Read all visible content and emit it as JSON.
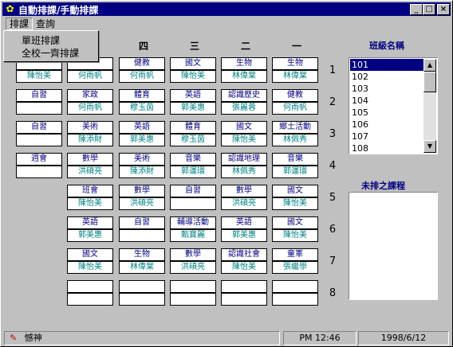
{
  "window": {
    "title": "自動排課/手動排課",
    "app_icon": "gear-icon"
  },
  "title_buttons": {
    "minimize": "_",
    "maximize": "□",
    "close": "×"
  },
  "menu": {
    "items": [
      {
        "label": "排課"
      },
      {
        "label": "查詢"
      }
    ]
  },
  "dropdown": {
    "items": [
      {
        "label": "單班排課"
      },
      {
        "label": "全校一齊排課"
      }
    ]
  },
  "days": [
    "四",
    "三",
    "二",
    "一"
  ],
  "periods": [
    "1",
    "2",
    "3",
    "4",
    "5",
    "6",
    "7",
    "8"
  ],
  "sections": {
    "class_list_title": "班級名稱",
    "unscheduled_title": "未排之課程"
  },
  "class_list": {
    "items": [
      "101",
      "102",
      "103",
      "104",
      "105",
      "106",
      "107",
      "108"
    ],
    "selected": "101"
  },
  "timetable": {
    "extra_col": [
      {
        "subject": "",
        "teacher": "陳怡美"
      },
      {
        "subject": "自習",
        "teacher": ""
      },
      {
        "subject": "自習",
        "teacher": ""
      },
      {
        "subject": "週會",
        "teacher": ""
      }
    ],
    "rows": [
      [
        {
          "subject": "",
          "teacher": "何雨帆"
        },
        {
          "subject": "健教",
          "teacher": "何雨帆"
        },
        {
          "subject": "國文",
          "teacher": "陳怡美"
        },
        {
          "subject": "生物",
          "teacher": "林偉棠"
        },
        {
          "subject": "生物",
          "teacher": "林偉棠"
        }
      ],
      [
        {
          "subject": "家政",
          "teacher": "何雨帆"
        },
        {
          "subject": "體育",
          "teacher": "穆玉茵"
        },
        {
          "subject": "英語",
          "teacher": "郭美惠"
        },
        {
          "subject": "認識歷史",
          "teacher": "張麗蓉"
        },
        {
          "subject": "健教",
          "teacher": "何雨帆"
        }
      ],
      [
        {
          "subject": "美術",
          "teacher": "陳添財"
        },
        {
          "subject": "英語",
          "teacher": "郭美惠"
        },
        {
          "subject": "體育",
          "teacher": "穆玉茵"
        },
        {
          "subject": "國文",
          "teacher": "陳怡美"
        },
        {
          "subject": "鄉土活動",
          "teacher": "林佩秀"
        }
      ],
      [
        {
          "subject": "數學",
          "teacher": "洪碩亮"
        },
        {
          "subject": "美術",
          "teacher": "陳添財"
        },
        {
          "subject": "音樂",
          "teacher": "郭運環"
        },
        {
          "subject": "認識地理",
          "teacher": "林佩秀"
        },
        {
          "subject": "音樂",
          "teacher": "郭運環"
        }
      ],
      [
        {
          "subject": "班會",
          "teacher": "陳怡美"
        },
        {
          "subject": "數學",
          "teacher": "洪碩亮"
        },
        {
          "subject": "自習",
          "teacher": ""
        },
        {
          "subject": "數學",
          "teacher": "洪碩亮"
        },
        {
          "subject": "國文",
          "teacher": "陳怡美"
        }
      ],
      [
        {
          "subject": "英語",
          "teacher": "郭美惠"
        },
        {
          "subject": "自習",
          "teacher": ""
        },
        {
          "subject": "輔導活動",
          "teacher": "甄寶麗"
        },
        {
          "subject": "英語",
          "teacher": "郭美惠"
        },
        {
          "subject": "國文",
          "teacher": "陳怡美"
        }
      ],
      [
        {
          "subject": "國文",
          "teacher": "陳怡美"
        },
        {
          "subject": "生物",
          "teacher": "林偉棠"
        },
        {
          "subject": "數學",
          "teacher": "洪碩亮"
        },
        {
          "subject": "認識社會",
          "teacher": "陳怡美"
        },
        {
          "subject": "童軍",
          "teacher": "張繼學"
        }
      ],
      [
        {
          "subject": "",
          "teacher": ""
        },
        {
          "subject": "",
          "teacher": ""
        },
        {
          "subject": "",
          "teacher": ""
        },
        {
          "subject": "",
          "teacher": ""
        },
        {
          "subject": "",
          "teacher": ""
        }
      ]
    ]
  },
  "status": {
    "icon": "pin-icon",
    "left_text": "憾神",
    "time": "PM 12:46",
    "date": "1998/6/12"
  },
  "colors": {
    "titlebar": "#000080",
    "subject_text": "#000080",
    "teacher_text": "#008080"
  }
}
